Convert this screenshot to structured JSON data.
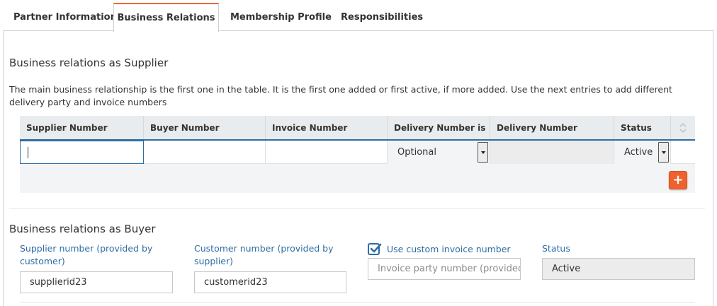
{
  "tabs": [
    {
      "label": "Partner Information",
      "active": false
    },
    {
      "label": "Business Relations",
      "active": true
    },
    {
      "label": "Membership Profile",
      "active": false
    },
    {
      "label": "Responsibilities",
      "active": false
    }
  ],
  "supplier_section": {
    "title": "Business relations as Supplier",
    "description": "The main business relationship is the first one in the table. It is the first one added or first active, if more added. Use the next entries to add different delivery party and invoice numbers",
    "columns": [
      "Supplier Number",
      "Buyer Number",
      "Invoice Number",
      "Delivery Number is",
      "Delivery Number",
      "Status"
    ],
    "row": {
      "supplier_number": "",
      "buyer_number": "",
      "invoice_number": "",
      "delivery_number_is": "Optional",
      "delivery_number": "",
      "status": "Active"
    },
    "add_button": "+"
  },
  "buyer_section": {
    "title": "Business relations as Buyer",
    "supplier_number_label": "Supplier number (provided by customer)",
    "supplier_number_value": "supplierid23",
    "customer_number_label": "Customer number (provided by supplier)",
    "customer_number_value": "customerid23",
    "custom_invoice_label": "Use custom invoice number",
    "custom_invoice_checked": true,
    "invoice_party_placeholder": "Invoice party number (provided",
    "status_label": "Status",
    "status_value": "Active"
  },
  "colors": {
    "accent": "#e8693a",
    "add_button": "#f0622d",
    "link_blue": "#2e6da4",
    "header_bg": "#e8ecee"
  }
}
